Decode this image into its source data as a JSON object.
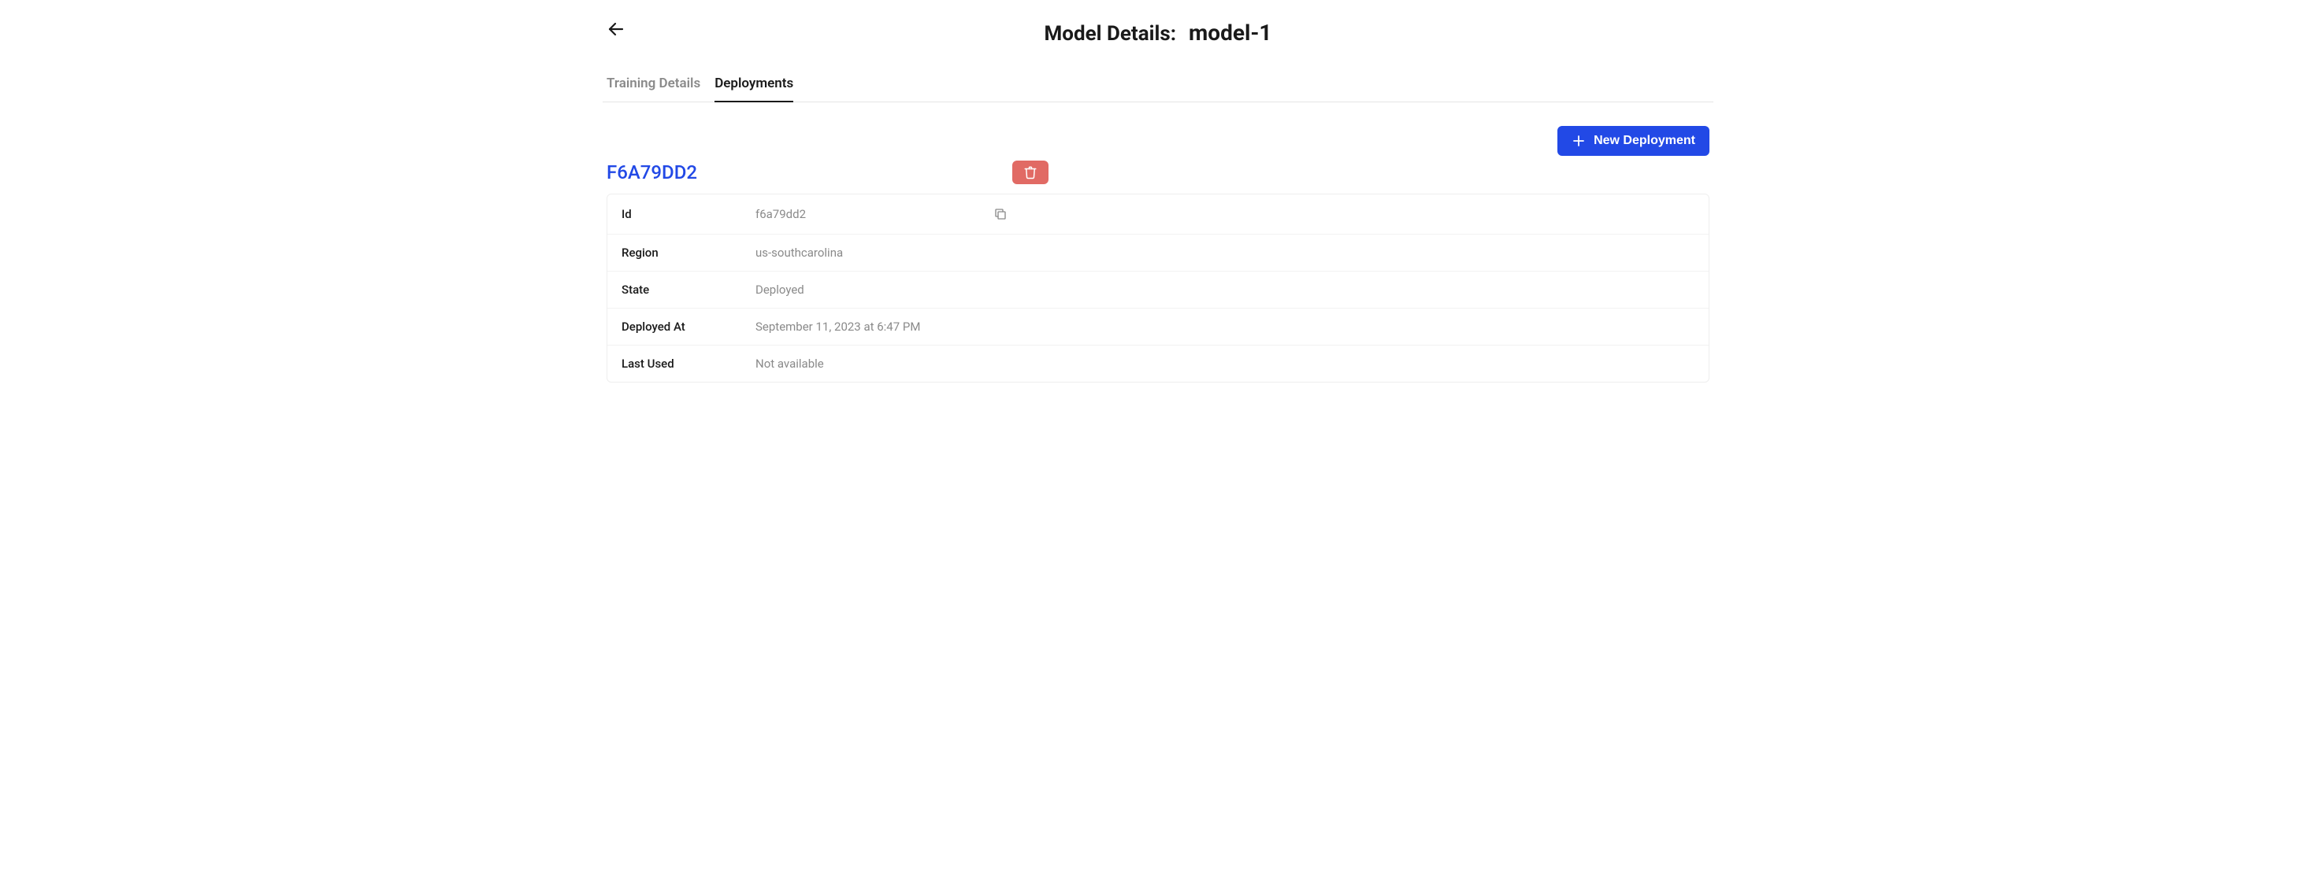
{
  "header": {
    "title_label": "Model Details:",
    "model_name": "model-1"
  },
  "tabs": [
    {
      "label": "Training Details",
      "active": false
    },
    {
      "label": "Deployments",
      "active": true
    }
  ],
  "actions": {
    "new_deployment_label": "New Deployment"
  },
  "deployment": {
    "display_id": "F6A79DD2",
    "rows": [
      {
        "label": "Id",
        "value": "f6a79dd2",
        "copyable": true
      },
      {
        "label": "Region",
        "value": "us-southcarolina",
        "copyable": false
      },
      {
        "label": "State",
        "value": "Deployed",
        "copyable": false
      },
      {
        "label": "Deployed At",
        "value": "September 11, 2023 at 6:47 PM",
        "copyable": false
      },
      {
        "label": "Last Used",
        "value": "Not available",
        "copyable": false
      }
    ]
  },
  "icons": {
    "back": "back-arrow-icon",
    "plus": "plus-icon",
    "trash": "trash-icon",
    "copy": "copy-icon"
  }
}
